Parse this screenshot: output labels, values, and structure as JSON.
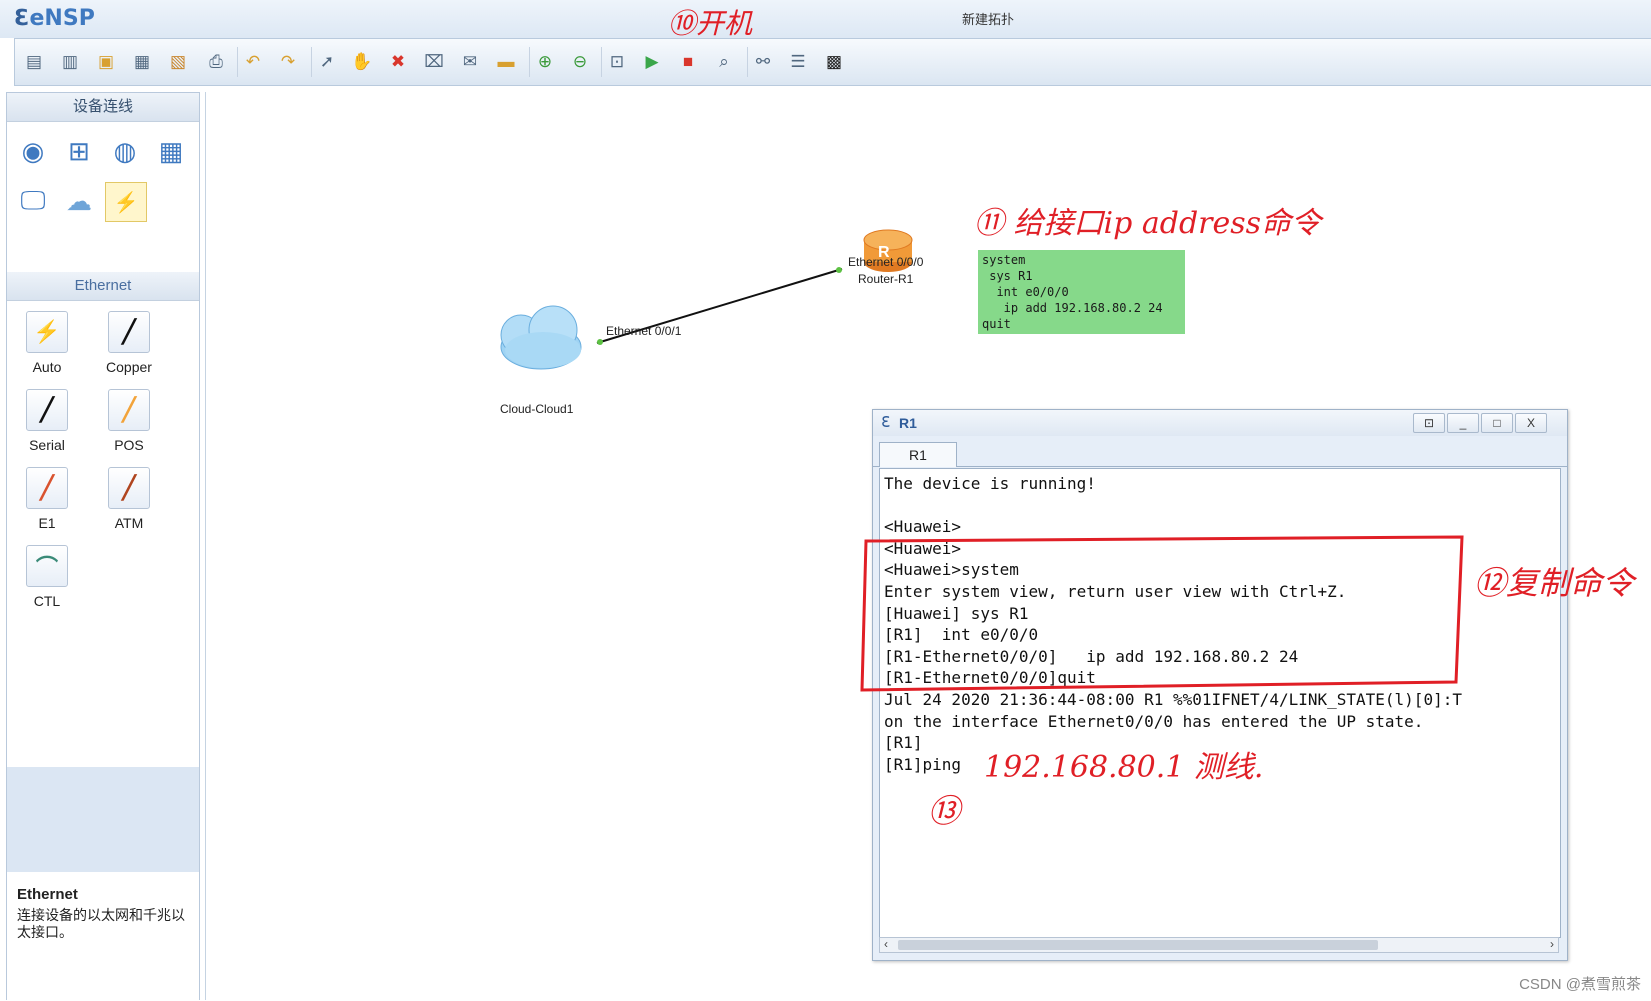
{
  "app": {
    "name": "eNSP",
    "window_title": "新建拓扑"
  },
  "toolbar": {
    "icons": [
      "new-topology-icon",
      "new-example-icon",
      "open-icon",
      "save-icon",
      "save-as-icon",
      "print-icon",
      "undo-icon",
      "redo-icon",
      "select-icon",
      "pan-hand-icon",
      "delete-icon",
      "delete-all-links-icon",
      "text-annotation-icon",
      "shape-icon",
      "zoom-in-icon",
      "zoom-out-icon",
      "fit-view-icon",
      "start-device-icon",
      "stop-device-icon",
      "capture-icon",
      "topology-view-icon",
      "device-list-icon",
      "console-icon"
    ]
  },
  "sidebar": {
    "devices_header": "设备连线",
    "device_icons": [
      "router-icon",
      "switch-icon",
      "wireless-icon",
      "firewall-icon",
      "pc-icon",
      "cloud-icon",
      "link-icon"
    ],
    "links_header": "Ethernet",
    "links": [
      {
        "label": "Auto",
        "glyph": "⚡",
        "color": "#222222"
      },
      {
        "label": "Copper",
        "glyph": "╱",
        "color": "#111111"
      },
      {
        "label": "Serial",
        "glyph": "╱",
        "color": "#111111"
      },
      {
        "label": "POS",
        "glyph": "╱",
        "color": "#f2a33a"
      },
      {
        "label": "E1",
        "glyph": "╱",
        "color": "#d9532f"
      },
      {
        "label": "ATM",
        "glyph": "╱",
        "color": "#b0451f"
      },
      {
        "label": "CTL",
        "glyph": "⌒",
        "color": "#3a8a78"
      }
    ],
    "info_title": "Ethernet",
    "info_desc": "连接设备的以太网和千兆以太接口。"
  },
  "topology": {
    "cloud_label": "Cloud-Cloud1",
    "cloud_port": "Ethernet 0/0/1",
    "router_label": "Router-R1",
    "router_port": "Ethernet 0/0/0",
    "router_badge": "R"
  },
  "note_box": "system\n sys R1\n  int e0/0/0\n   ip add 192.168.80.2 24\nquit",
  "terminal": {
    "title": "R1",
    "tab": "R1",
    "buttons": [
      "⊡",
      "_",
      "□",
      "X"
    ],
    "lines": [
      "The device is running!",
      "",
      "<Huawei>",
      "<Huawei>",
      "<Huawei>system",
      "Enter system view, return user view with Ctrl+Z.",
      "[Huawei] sys R1",
      "[R1]  int e0/0/0",
      "[R1-Ethernet0/0/0]   ip add 192.168.80.2 24",
      "[R1-Ethernet0/0/0]quit",
      "Jul 24 2020 21:36:44-08:00 R1 %%01IFNET/4/LINK_STATE(l)[0]:T",
      "on the interface Ethernet0/0/0 has entered the UP state.",
      "[R1]",
      "[R1]ping"
    ]
  },
  "annotations": {
    "a10": "⑩开机",
    "a11": "⑪ 给接口ip address命令",
    "a12": "⑫复制命令",
    "a13_text": "192.168.80.1 测线.",
    "a13_num": "⑬"
  },
  "watermark": "CSDN @煮雪煎茶",
  "colors": {
    "annotation": "#e01f26",
    "accent": "#3f79c0",
    "note_bg": "#86d98a"
  }
}
